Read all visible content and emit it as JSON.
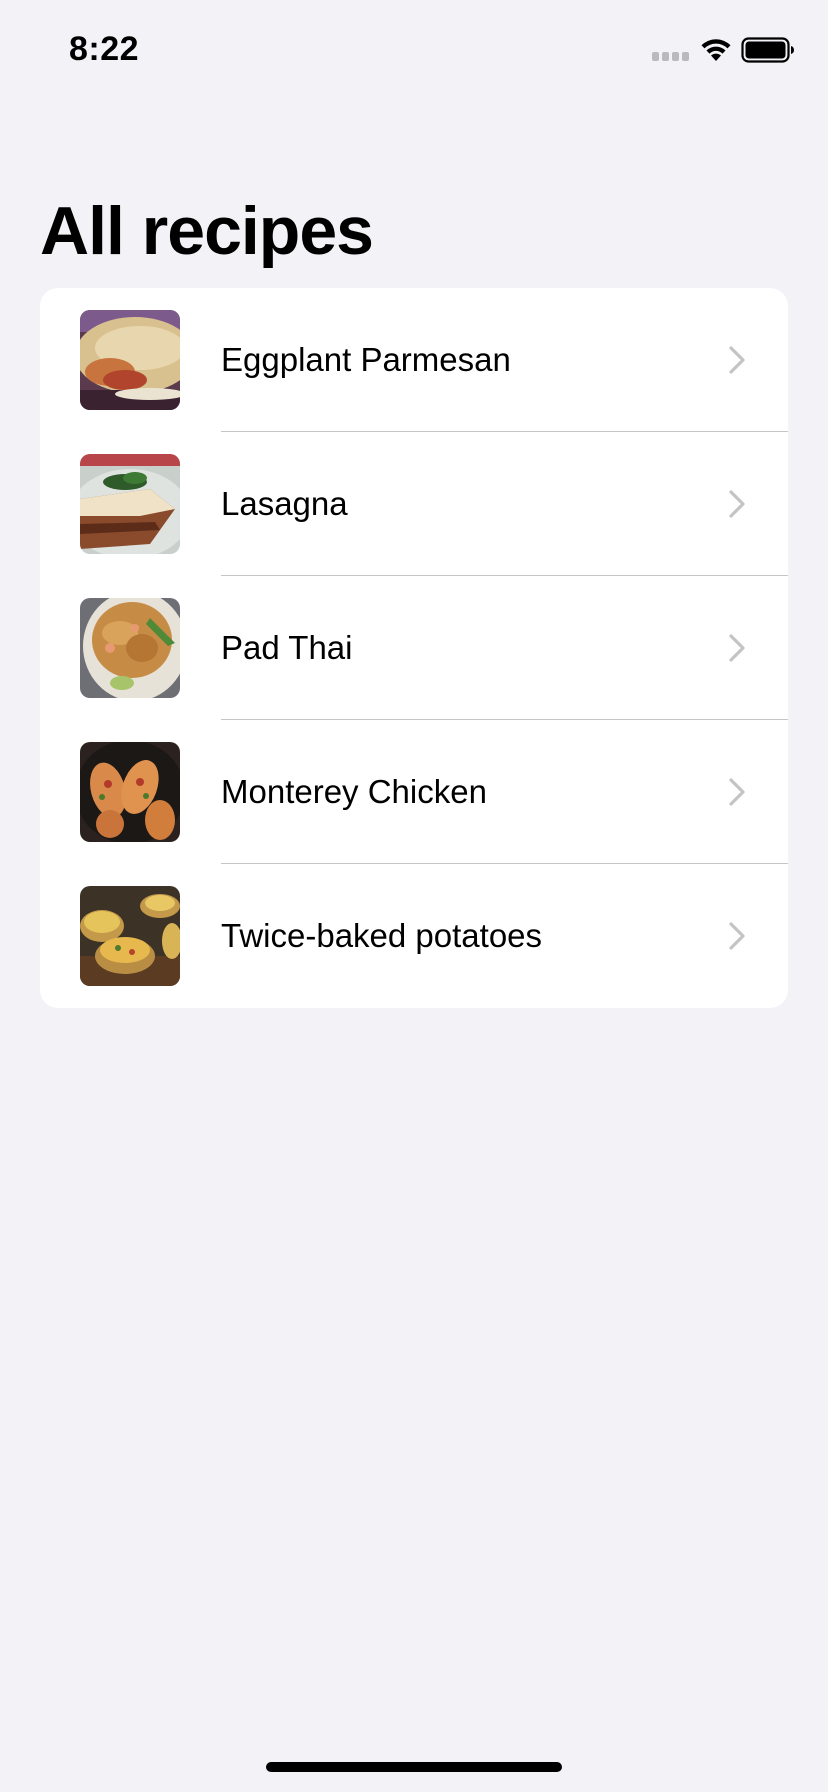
{
  "status_bar": {
    "time": "8:22",
    "icons": [
      "signal-icon",
      "wifi-icon",
      "battery-icon"
    ]
  },
  "page": {
    "title": "All recipes",
    "background": "#f2f2f7"
  },
  "recipes": [
    {
      "name": "Eggplant Parmesan",
      "thumbnail": "eggplant-parmesan-photo",
      "accessory": "chevron-right-icon"
    },
    {
      "name": "Lasagna",
      "thumbnail": "lasagna-photo",
      "accessory": "chevron-right-icon"
    },
    {
      "name": "Pad Thai",
      "thumbnail": "pad-thai-photo",
      "accessory": "chevron-right-icon"
    },
    {
      "name": "Monterey Chicken",
      "thumbnail": "monterey-chicken-photo",
      "accessory": "chevron-right-icon"
    },
    {
      "name": "Twice-baked potatoes",
      "thumbnail": "twice-baked-potatoes-photo",
      "accessory": "chevron-right-icon"
    }
  ],
  "colors": {
    "card": "#ffffff",
    "separator": "#c6c6c8",
    "chevron": "#c4c4c7",
    "text": "#000000"
  }
}
